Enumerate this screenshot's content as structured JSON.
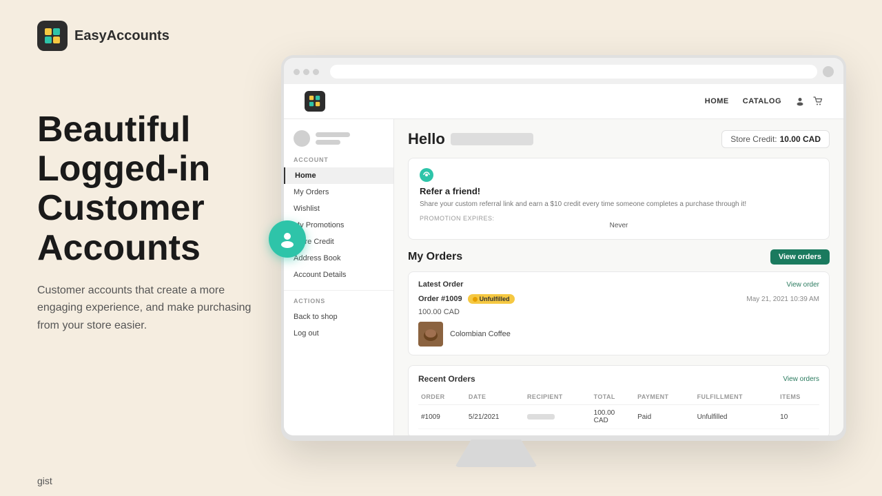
{
  "app": {
    "logo_label": "EasyAccounts",
    "gist_text": "gist"
  },
  "left": {
    "title": "Beautiful Logged-in Customer Accounts",
    "description": "Customer accounts that create a more engaging experience, and make purchasing from your store easier."
  },
  "store": {
    "nav": {
      "links": [
        "HOME",
        "CATALOG"
      ],
      "home_label": "HOME",
      "catalog_label": "CATALOG"
    },
    "sidebar": {
      "section_account": "ACCOUNT",
      "section_actions": "ACTIONS",
      "items_account": [
        "Home",
        "My Orders",
        "Wishlist",
        "My Promotions",
        "Store Credit",
        "Address Book",
        "Account Details"
      ],
      "items_actions": [
        "Back to shop",
        "Log out"
      ],
      "active_item": "Home"
    },
    "hello_text": "Hello",
    "store_credit_label": "Store Credit:",
    "store_credit_amount": "10.00 CAD",
    "referral": {
      "title": "Refer a friend!",
      "description": "Share your custom referral link and earn a $10 credit every time someone completes a purchase through it!",
      "expires_label": "Promotion Expires:",
      "expires_value": "Never"
    },
    "my_orders": {
      "title": "My Orders",
      "view_button": "View orders",
      "latest": {
        "title": "Latest Order",
        "view_link": "View order",
        "order_number": "Order #1009",
        "status": "Unfulfilled",
        "date": "May 21, 2021 10:39 AM",
        "total": "100.00 CAD",
        "product_name": "Colombian Coffee"
      },
      "recent": {
        "title": "Recent Orders",
        "view_link": "View orders",
        "columns": [
          "ORDER",
          "DATE",
          "RECIPIENT",
          "TOTAL",
          "PAYMENT",
          "FULFILLMENT",
          "ITEMS"
        ],
        "rows": [
          {
            "order": "#1009",
            "date": "5/21/2021",
            "recipient": "",
            "total": "100.00 CAD",
            "payment": "Paid",
            "fulfillment": "Unfulfilled",
            "items": "10"
          }
        ]
      }
    }
  }
}
